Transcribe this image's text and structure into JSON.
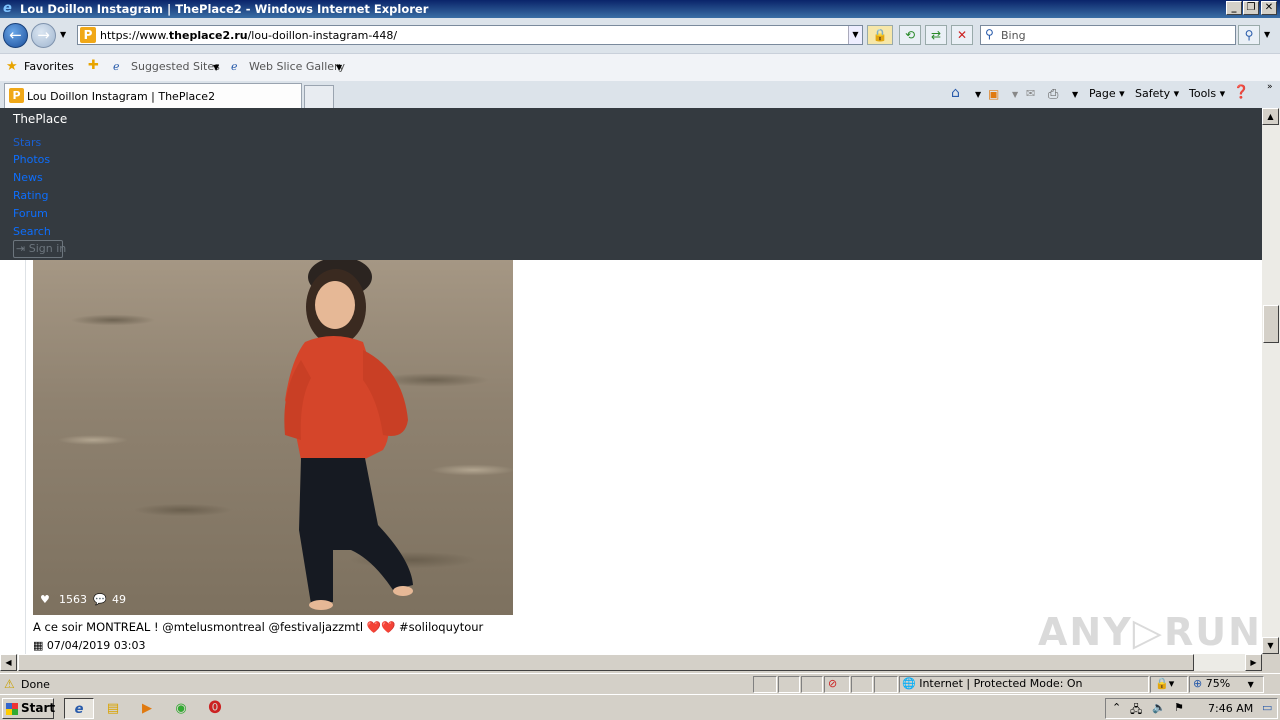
{
  "window": {
    "title": "Lou Doillon Instagram | ThePlace2 - Windows Internet Explorer"
  },
  "address": {
    "url_prefix": "https://www.",
    "url_domain": "theplace2.ru",
    "url_path": "/lou-doillon-instagram-448/"
  },
  "search": {
    "placeholder": "Bing"
  },
  "favorites": {
    "label": "Favorites",
    "items": [
      "Suggested Sites",
      "Web Slice Gallery"
    ]
  },
  "tabs": [
    {
      "label": "Lou Doillon Instagram | ThePlace2"
    }
  ],
  "commandbar": {
    "page": "Page",
    "safety": "Safety",
    "tools": "Tools"
  },
  "site": {
    "brand": "ThePlace",
    "nav": [
      "Stars",
      "Photos",
      "News",
      "Rating",
      "Forum",
      "Search"
    ],
    "signin": "Sign in"
  },
  "post": {
    "likes": "1563",
    "comments": "49",
    "caption": "A ce soir MONTREAL ! @mtelusmontreal @festivaljazzmtl ❤️❤️ #soliloquytour",
    "date": "07/04/2019 03:03"
  },
  "status": {
    "text": "Done",
    "zone": "Internet | Protected Mode: On",
    "zoom": "75%"
  },
  "taskbar": {
    "start": "Start",
    "time": "7:46 AM"
  },
  "watermark": "ANY RUN",
  "colors": {
    "site_header": "#343a40",
    "link": "#0d6efd",
    "titlebar": "#0a246a"
  }
}
